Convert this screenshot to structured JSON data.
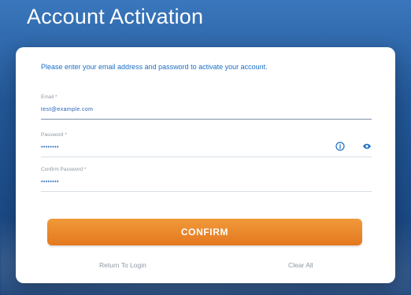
{
  "page": {
    "title": "Account Activation"
  },
  "form": {
    "instruction": "Please enter your email address and password to activate your account.",
    "email": {
      "label": "Email *",
      "value": "test@example.com"
    },
    "password": {
      "label": "Password *",
      "value": "••••••••"
    },
    "confirm_password": {
      "label": "Confirm Password *",
      "value": "••••••••"
    },
    "buttons": {
      "confirm": "CONFIRM"
    },
    "links": {
      "return_to_login": "Return To Login",
      "clear_all": "Clear All"
    }
  },
  "colors": {
    "primary": "#1b6fc6",
    "accent": "#e4781f",
    "muted": "#8d98a5"
  },
  "icons": {
    "password_info": "info-icon",
    "password_visibility": "eye-icon"
  }
}
